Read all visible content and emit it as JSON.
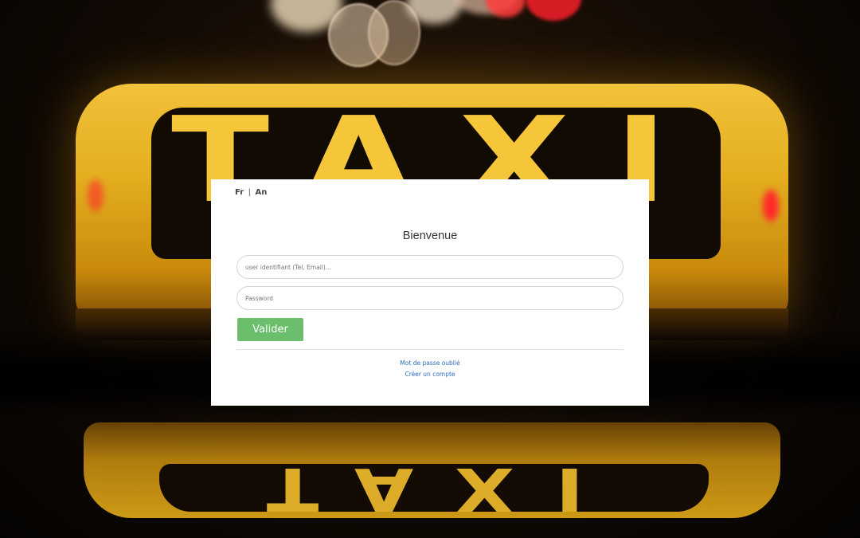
{
  "background": {
    "sign_text": "TAXI",
    "reflection_text": "TAXI"
  },
  "language": {
    "fr_label": "Fr",
    "separator": "|",
    "en_label": "An"
  },
  "login": {
    "title": "Bienvenue",
    "user_placeholder": "user identifiant (Tel, Email)...",
    "password_placeholder": "Password",
    "submit_label": "Valider",
    "forgot_password_label": "Mot de passe oublié",
    "create_account_label": "Créer un compte"
  },
  "colors": {
    "submit_button": "#5cb85c",
    "link": "#2a6ab8",
    "sign_yellow": "#f2c23a"
  }
}
